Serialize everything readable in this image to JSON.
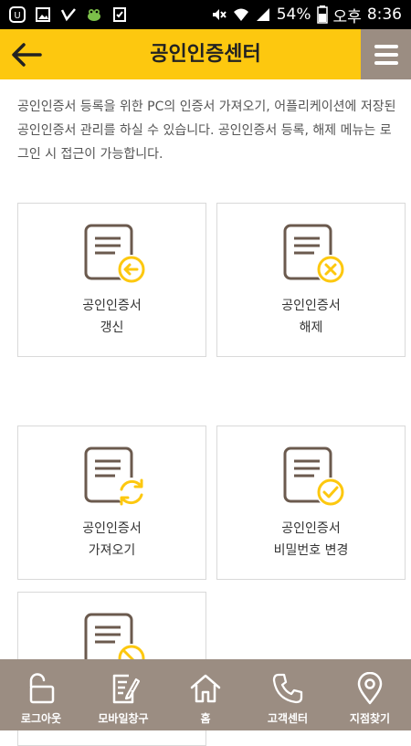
{
  "status_bar": {
    "battery": "54%",
    "ampm": "오후",
    "time": "8:36"
  },
  "header": {
    "title": "공인인증센터"
  },
  "intro": "공인인증서 등록을 위한 PC의 인증서 가져오기, 어플리케이션에 저장된 공인인증서 관리를 하실 수 있습니다. 공인인증서 등록, 해제 메뉴는 로그인 시 접근이 가능합니다.",
  "cards": [
    {
      "line1": "공인인증서",
      "line2": "갱신",
      "icon": "certificate-renew-icon"
    },
    {
      "line1": "공인인증서",
      "line2": "해제",
      "icon": "certificate-remove-icon"
    },
    {
      "line1": "공인인증서",
      "line2": "가져오기",
      "icon": "certificate-import-icon"
    },
    {
      "line1": "공인인증서",
      "line2": "비밀번호 변경",
      "icon": "certificate-password-icon"
    },
    {
      "line1": "",
      "line2": "",
      "icon": "certificate-block-icon"
    }
  ],
  "bottom_nav": [
    {
      "label": "로그아웃",
      "icon": "unlock-icon"
    },
    {
      "label": "모바일창구",
      "icon": "edit-document-icon"
    },
    {
      "label": "홈",
      "icon": "home-icon"
    },
    {
      "label": "고객센터",
      "icon": "phone-icon"
    },
    {
      "label": "지점찾기",
      "icon": "location-pin-icon"
    }
  ],
  "colors": {
    "accent": "#fdc80f",
    "nav_bg": "#9b8d82",
    "icon_brown": "#6b5a4e"
  }
}
